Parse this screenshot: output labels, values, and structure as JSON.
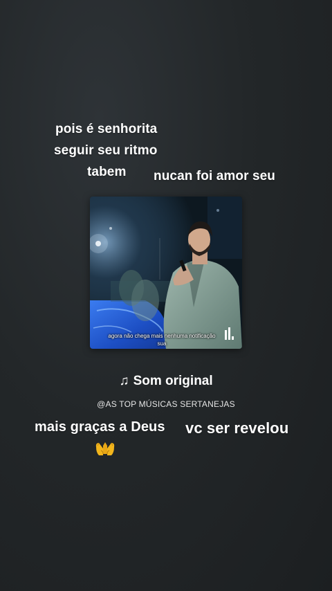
{
  "overlay_texts": {
    "line1": "pois é senhorita",
    "line2": "seguir seu ritmo",
    "line3": "tabem",
    "line4": "nucan foi amor seu",
    "line5": "mais graças a Deus",
    "line6": "vc ser revelou"
  },
  "video": {
    "caption_line1": "agora não chega mais nenhuma notificação",
    "caption_line2": "sua",
    "icon": "equalizer-bars-icon"
  },
  "sound": {
    "icon": "music-note-icon",
    "note_glyph": "♫",
    "title": "Som original",
    "account": "@AS TOP MÚSICAS SERTANEJAS"
  },
  "emoji": {
    "icon": "praying-hands-icon"
  },
  "colors": {
    "background": "#232729",
    "text": "#ffffff",
    "stage_blue": "#2a5fd6",
    "emoji_yellow": "#f2b51c"
  }
}
